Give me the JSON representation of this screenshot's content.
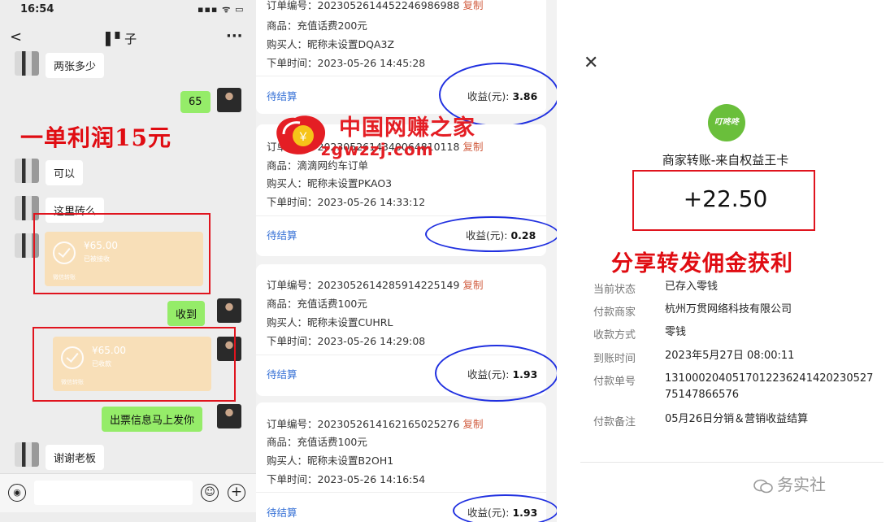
{
  "chat": {
    "time": "16:54",
    "status_icons": "▪▪▪ ᯤ ▭",
    "contact": "▌▘子",
    "more": "···",
    "messages": {
      "m1": "两张多少",
      "m2": "65",
      "m3": "可以",
      "m4": "这里砖么",
      "m5": "收到",
      "m6": "出票信息马上发你",
      "m7": "谢谢老板"
    },
    "transfer1": {
      "amount": "¥65.00",
      "status": "已被接收",
      "footer": "微信转账"
    },
    "transfer2": {
      "amount": "¥65.00",
      "status": "已收款",
      "footer": "微信转账"
    },
    "overlay": "一单利润15元"
  },
  "orders": {
    "copy": "复制",
    "pending": "待结算",
    "earn_label": "收益(元):",
    "cards": [
      {
        "id": "订单编号：2023052614452246986988",
        "product": "商品：充值话费200元",
        "buyer": "购买人：昵称未设置DQA3Z",
        "time": "下单时间：2023-05-26 14:45:28",
        "earn": "3.86"
      },
      {
        "id": "订单编号：2023052614340064810118",
        "product": "商品：滴滴网约车订单",
        "buyer": "购买人：昵称未设置PKAO3",
        "time": "下单时间：2023-05-26 14:33:12",
        "earn": "0.28"
      },
      {
        "id": "订单编号：2023052614285914225149",
        "product": "商品：充值话费100元",
        "buyer": "购买人：昵称未设置CUHRL",
        "time": "下单时间：2023-05-26 14:29:08",
        "earn": "1.93"
      },
      {
        "id": "订单编号：2023052614162165025276",
        "product": "商品：充值话费100元",
        "buyer": "购买人：昵称未设置B2OH1",
        "time": "下单时间：2023-05-26 14:16:54",
        "earn": "1.93"
      }
    ],
    "watermark": {
      "name": "中国网赚之家",
      "url": "zgwzzj.com",
      "logo_symbol": "￥"
    }
  },
  "receipt": {
    "close": "✕",
    "logo_text": "叮咚咚",
    "merchant": "商家转账-来自权益王卡",
    "amount": "+22.50",
    "overlay": "分享转发佣金获利",
    "rows": [
      {
        "label": "当前状态",
        "value": "已存入零钱"
      },
      {
        "label": "付款商家",
        "value": "杭州万贯网络科技有限公司"
      },
      {
        "label": "收款方式",
        "value": "零钱"
      },
      {
        "label": "到账时间",
        "value": "2023年5月27日 08:00:11"
      },
      {
        "label": "付款单号",
        "value": "131000204051701223624142023052775147866576"
      },
      {
        "label": "付款备注",
        "value": "05月26日分销＆营销收益结算"
      }
    ],
    "footer": "务实社"
  },
  "colors": {
    "accent_red": "#e00c12",
    "circle_blue": "#2030e0",
    "chat_green": "#95ec69",
    "link_blue": "#3570d6"
  }
}
